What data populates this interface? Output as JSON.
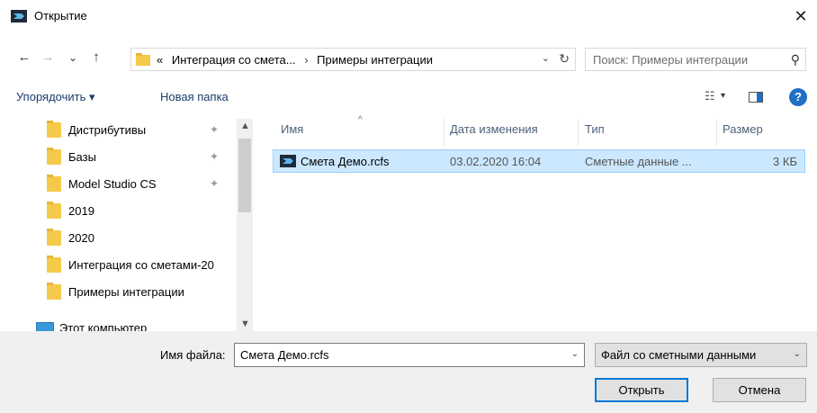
{
  "window": {
    "title": "Открытие",
    "close_glyph": "✕"
  },
  "nav": {
    "back": "←",
    "forward": "→",
    "recent": "⌄",
    "up": "↑"
  },
  "address": {
    "prefix": "«",
    "segments": [
      "Интеграция со смета...",
      "Примеры интеграции"
    ],
    "separator": "›",
    "dropdown": "⌄",
    "refresh": "↻"
  },
  "search": {
    "placeholder": "Поиск: Примеры интеграции",
    "icon": "⚲"
  },
  "toolbar": {
    "organize_label": "Упорядочить ▾",
    "new_folder_label": "Новая папка",
    "view_glyph": "☷",
    "view_drop": "▾",
    "help_glyph": "?"
  },
  "sidebar": {
    "items": [
      {
        "label": "Дистрибутивы",
        "pinned": true,
        "pin": "✦"
      },
      {
        "label": "Базы",
        "pinned": true,
        "pin": "✦"
      },
      {
        "label": "Model Studio CS",
        "pinned": true,
        "pin": "✦"
      },
      {
        "label": "2019"
      },
      {
        "label": "2020"
      },
      {
        "label": "Интеграция со сметами-20"
      },
      {
        "label": "Примеры интеграции"
      },
      {
        "label": "Этот компьютер"
      }
    ],
    "scroll_up": "▲",
    "scroll_down": "▼"
  },
  "columns": {
    "name": "Имя",
    "date": "Дата изменения",
    "type": "Тип",
    "size": "Размер",
    "sort_caret": "^"
  },
  "files": [
    {
      "name": "Смета Демо.rcfs",
      "date": "03.02.2020 16:04",
      "type": "Сметные данные ...",
      "size": "3 КБ"
    }
  ],
  "footer": {
    "filename_label": "Имя файла:",
    "filename_value": "Смета Демо.rcfs",
    "filename_drop": "⌄",
    "filter_value": "Файл со сметными данными",
    "filter_drop": "⌄",
    "open_label": "Открыть",
    "cancel_label": "Отмена"
  },
  "colors": {
    "accent": "#0078d7",
    "selection": "#cce8ff",
    "folder": "#f5c94a",
    "link": "#1a3f6b"
  }
}
